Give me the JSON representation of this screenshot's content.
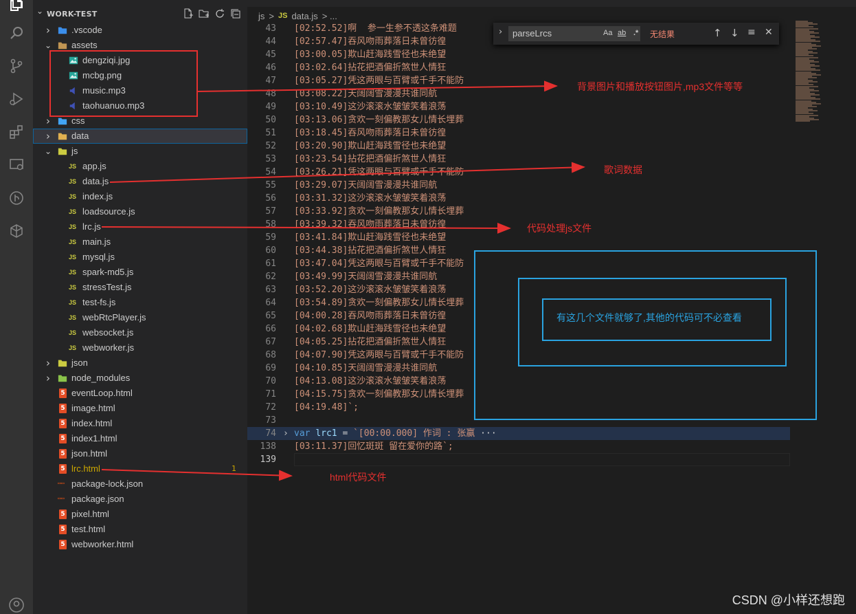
{
  "explorer": {
    "title": "WORK-TEST",
    "actions": [
      "new-file-icon",
      "new-folder-icon",
      "refresh-icon",
      "collapse-all-icon"
    ],
    "items": [
      {
        "label": ".vscode",
        "type": "folder",
        "level": 1,
        "expanded": false,
        "icon": "vscode-folder-icon"
      },
      {
        "label": "assets",
        "type": "folder",
        "level": 1,
        "expanded": true,
        "icon": "assets-folder-icon"
      },
      {
        "label": "dengziqi.jpg",
        "type": "image",
        "level": 2
      },
      {
        "label": "mcbg.png",
        "type": "image",
        "level": 2
      },
      {
        "label": "music.mp3",
        "type": "audio",
        "level": 2
      },
      {
        "label": "taohuanuo.mp3",
        "type": "audio",
        "level": 2
      },
      {
        "label": "css",
        "type": "folder",
        "level": 1,
        "expanded": false,
        "icon": "css-folder-icon"
      },
      {
        "label": "data",
        "type": "folder",
        "level": 1,
        "expanded": false,
        "icon": "data-folder-icon",
        "selected": true
      },
      {
        "label": "js",
        "type": "folder",
        "level": 1,
        "expanded": true,
        "icon": "js-folder-icon"
      },
      {
        "label": "app.js",
        "type": "js",
        "level": 2
      },
      {
        "label": "data.js",
        "type": "js",
        "level": 2
      },
      {
        "label": "index.js",
        "type": "js",
        "level": 2
      },
      {
        "label": "loadsource.js",
        "type": "js",
        "level": 2
      },
      {
        "label": "lrc.js",
        "type": "js",
        "level": 2
      },
      {
        "label": "main.js",
        "type": "js",
        "level": 2
      },
      {
        "label": "mysql.js",
        "type": "js",
        "level": 2
      },
      {
        "label": "spark-md5.js",
        "type": "js",
        "level": 2
      },
      {
        "label": "stressTest.js",
        "type": "js",
        "level": 2
      },
      {
        "label": "test-fs.js",
        "type": "js",
        "level": 2
      },
      {
        "label": "webRtcPlayer.js",
        "type": "js",
        "level": 2
      },
      {
        "label": "websocket.js",
        "type": "js",
        "level": 2
      },
      {
        "label": "webworker.js",
        "type": "js",
        "level": 2
      },
      {
        "label": "json",
        "type": "folder",
        "level": 1,
        "expanded": false,
        "icon": "json-folder-icon"
      },
      {
        "label": "node_modules",
        "type": "folder",
        "level": 1,
        "expanded": false,
        "icon": "node-folder-icon"
      },
      {
        "label": "eventLoop.html",
        "type": "html",
        "level": 1
      },
      {
        "label": "image.html",
        "type": "html",
        "level": 1
      },
      {
        "label": "index.html",
        "type": "html",
        "level": 1
      },
      {
        "label": "index1.html",
        "type": "html",
        "level": 1
      },
      {
        "label": "json.html",
        "type": "html",
        "level": 1
      },
      {
        "label": "lrc.html",
        "type": "html",
        "level": 1,
        "badge": "1",
        "warning": true
      },
      {
        "label": "package-lock.json",
        "type": "json",
        "level": 1
      },
      {
        "label": "package.json",
        "type": "json",
        "level": 1
      },
      {
        "label": "pixel.html",
        "type": "html",
        "level": 1
      },
      {
        "label": "test.html",
        "type": "html",
        "level": 1
      },
      {
        "label": "webworker.html",
        "type": "html",
        "level": 1
      }
    ]
  },
  "breadcrumb": {
    "folder": "js",
    "sep": ">",
    "file_tag": "JS",
    "file": "data.js",
    "tail": "> ..."
  },
  "find": {
    "query": "parseLrcs",
    "match_case": "Aa",
    "whole_word": "ab",
    "regex": ".*",
    "result": "无结果"
  },
  "code_lines": [
    {
      "n": "43",
      "t": "[02:52.52]啊  参一生参不透这条难题"
    },
    {
      "n": "44",
      "t": "[02:57.47]吞风吻雨葬落日未曾彷徨"
    },
    {
      "n": "45",
      "t": "[03:00.05]欺山赶海践雪径也未绝望"
    },
    {
      "n": "46",
      "t": "[03:02.64]拈花把酒偏折煞世人情狂"
    },
    {
      "n": "47",
      "t": "[03:05.27]凭这两眼与百臂或千手不能防"
    },
    {
      "n": "48",
      "t": "[03:08.22]天阔阔雪漫漫共谁同航"
    },
    {
      "n": "49",
      "t": "[03:10.49]这沙滚滚水皱皱笑着浪荡"
    },
    {
      "n": "50",
      "t": "[03:13.06]贪欢一刻偏教那女儿情长埋葬"
    },
    {
      "n": "51",
      "t": "[03:18.45]吞风吻雨葬落日未曾彷徨"
    },
    {
      "n": "52",
      "t": "[03:20.90]欺山赶海践雪径也未绝望"
    },
    {
      "n": "53",
      "t": "[03:23.54]拈花把酒偏折煞世人情狂"
    },
    {
      "n": "54",
      "t": "[03:26.21]凭这两眼与百臂或千手不能防"
    },
    {
      "n": "55",
      "t": "[03:29.07]天阔阔雪漫漫共谁同航"
    },
    {
      "n": "56",
      "t": "[03:31.32]这沙滚滚水皱皱笑着浪荡"
    },
    {
      "n": "57",
      "t": "[03:33.92]贪欢一刻偏教那女儿情长埋葬"
    },
    {
      "n": "58",
      "t": "[03:39.32]吞风吻雨葬落日未曾彷徨"
    },
    {
      "n": "59",
      "t": "[03:41.84]欺山赶海践雪径也未绝望"
    },
    {
      "n": "60",
      "t": "[03:44.38]拈花把酒偏折煞世人情狂"
    },
    {
      "n": "61",
      "t": "[03:47.04]凭这两眼与百臂或千手不能防"
    },
    {
      "n": "62",
      "t": "[03:49.99]天阔阔雪漫漫共谁同航"
    },
    {
      "n": "63",
      "t": "[03:52.20]这沙滚滚水皱皱笑着浪荡"
    },
    {
      "n": "64",
      "t": "[03:54.89]贪欢一刻偏教那女儿情长埋葬"
    },
    {
      "n": "65",
      "t": "[04:00.28]吞风吻雨葬落日未曾彷徨"
    },
    {
      "n": "66",
      "t": "[04:02.68]欺山赶海践雪径也未绝望"
    },
    {
      "n": "67",
      "t": "[04:05.25]拈花把酒偏折煞世人情狂"
    },
    {
      "n": "68",
      "t": "[04:07.90]凭这两眼与百臂或千手不能防"
    },
    {
      "n": "69",
      "t": "[04:10.85]天阔阔雪漫漫共谁同航"
    },
    {
      "n": "70",
      "t": "[04:13.08]这沙滚滚水皱皱笑着浪荡"
    },
    {
      "n": "71",
      "t": "[04:15.75]贪欢一刻偏教那女儿情长埋葬"
    },
    {
      "n": "72",
      "t": "[04:19.48]`;"
    },
    {
      "n": "73",
      "t": ""
    },
    {
      "n": "74",
      "t": "",
      "special": "var",
      "kw": "var",
      "name": "lrc1",
      "eq": " = ",
      "str": "`[00:00.000] 作词 : 张赢",
      "ellipsis": "···"
    },
    {
      "n": "138",
      "t": "[03:11.37]回忆斑斑 留在爱你的路`;"
    },
    {
      "n": "139",
      "t": "",
      "active": true
    }
  ],
  "annotations": {
    "assets_note": "背景图片和播放按钮图片,mp3文件等等",
    "data_note": "歌词数据",
    "lrc_js_note": "代码处理js文件",
    "html_note": "html代码文件",
    "blue_note": "有这几个文件就够了,其他的代码可不必查看"
  },
  "watermark": "CSDN @小样还想跑",
  "colors": {
    "annotation_red": "#e5302f",
    "annotation_blue": "#2aa3e0",
    "string": "#ce9178",
    "keyword": "#569cd6",
    "warning": "#cca700"
  }
}
